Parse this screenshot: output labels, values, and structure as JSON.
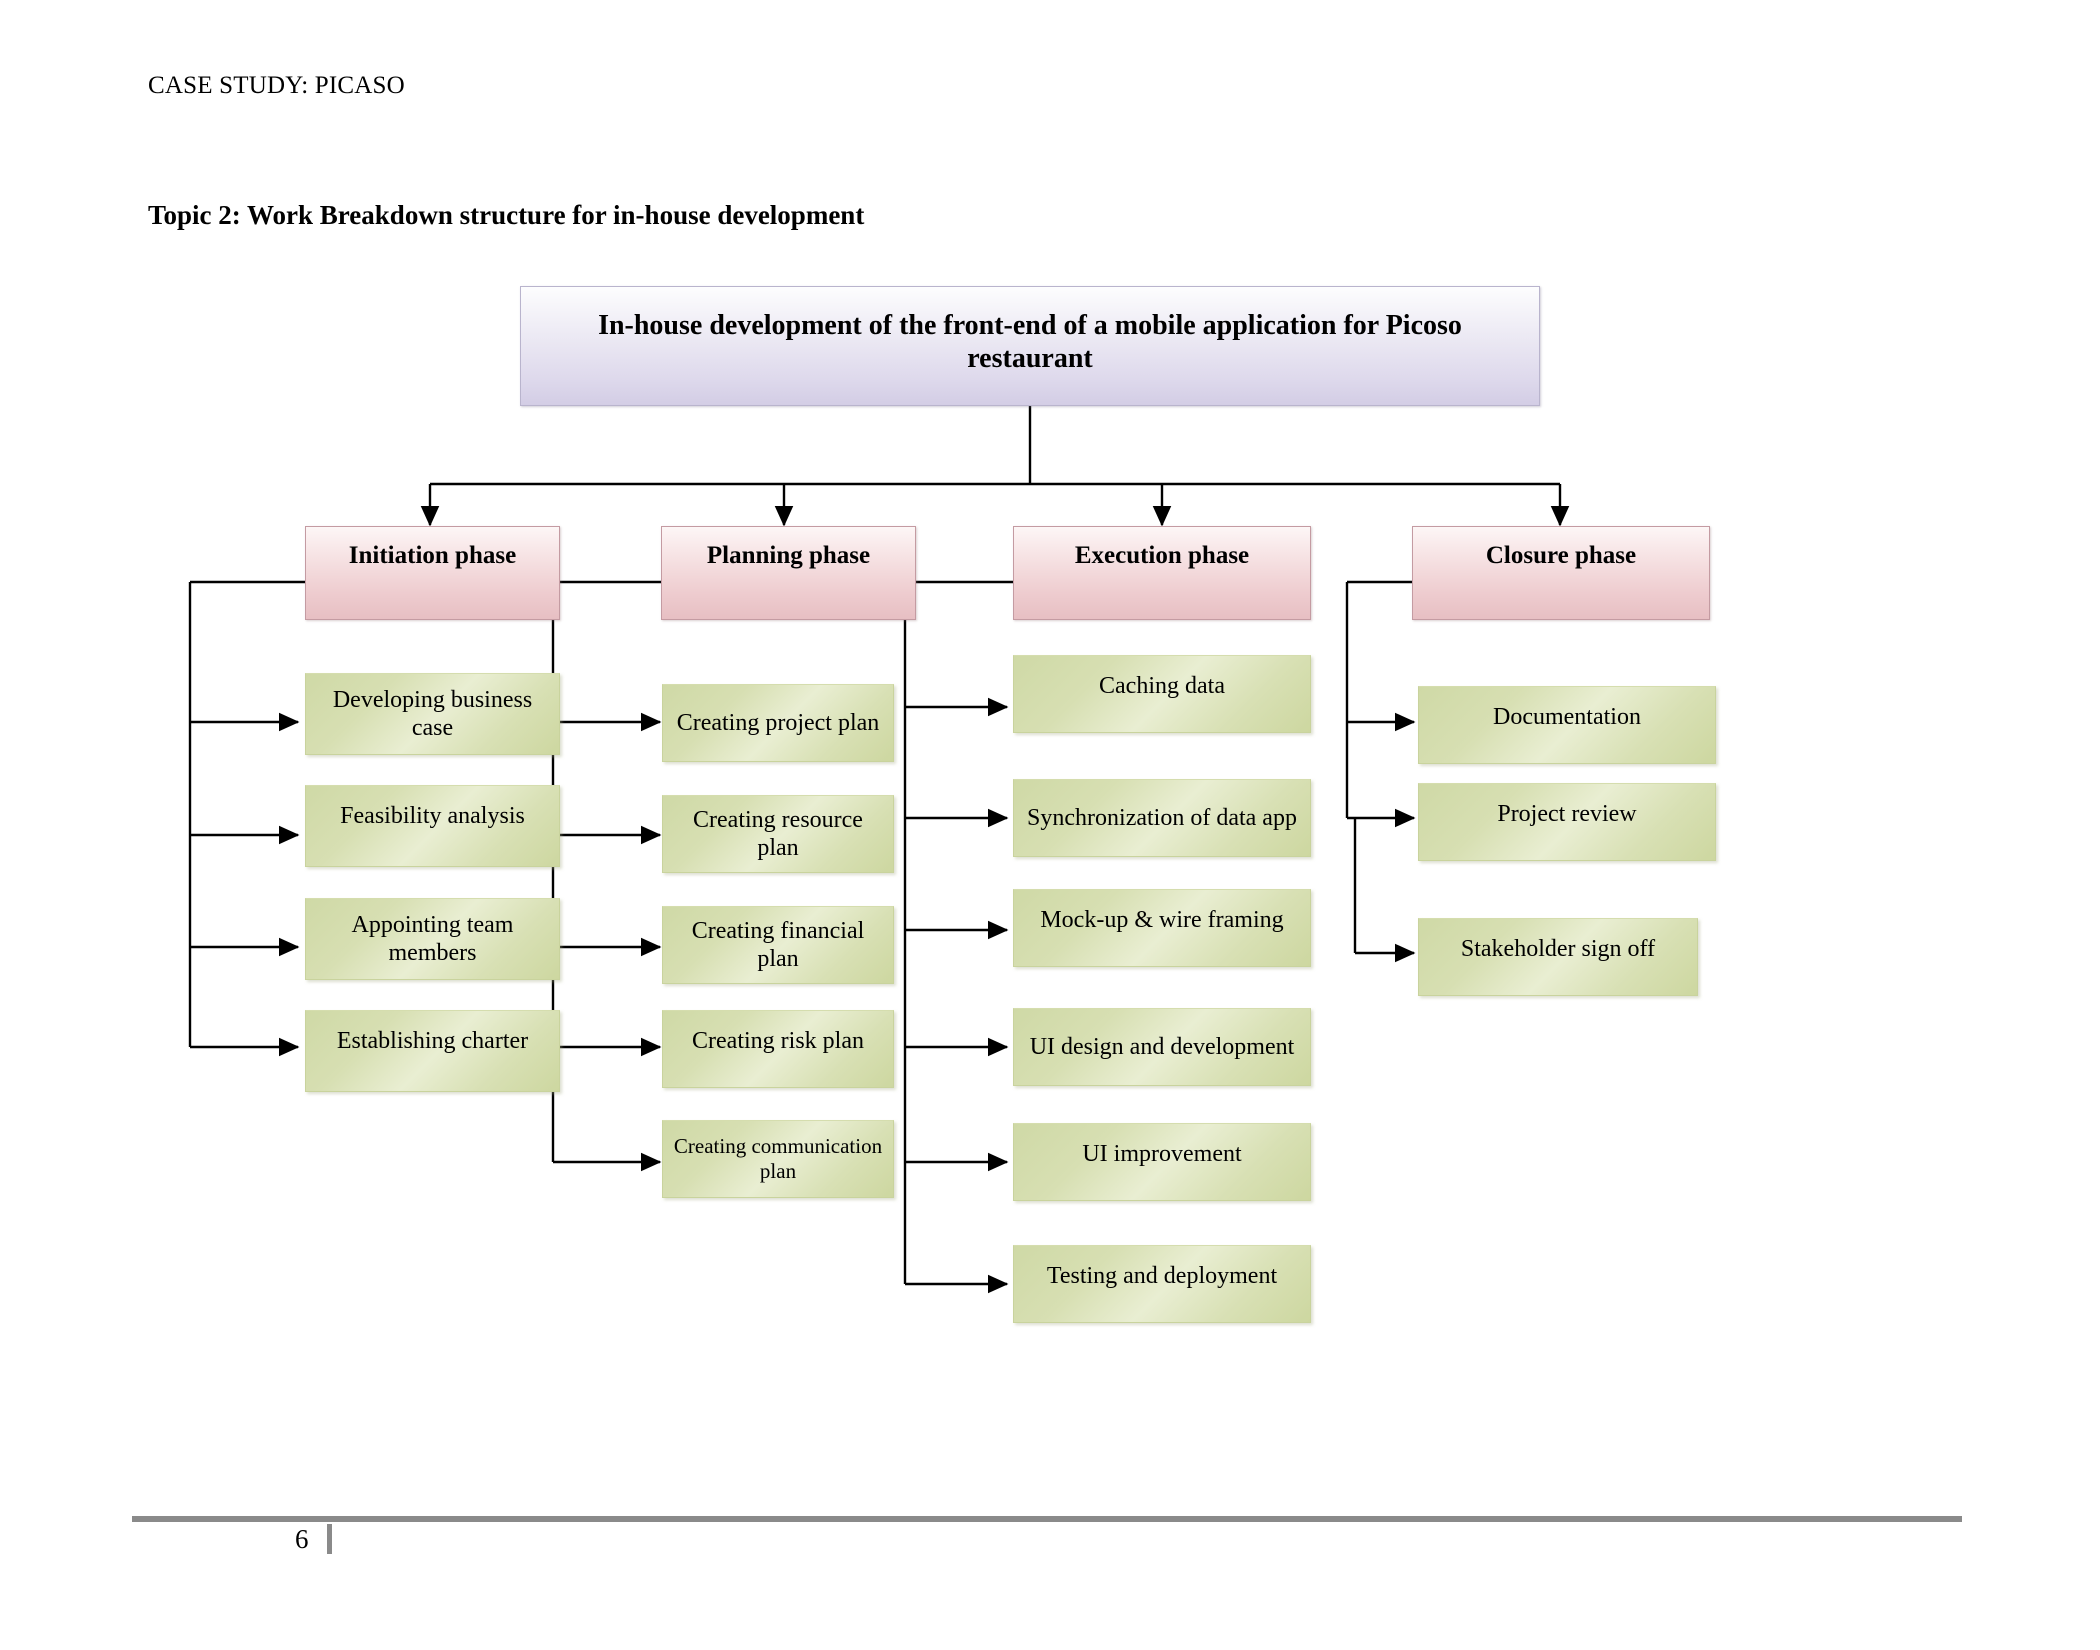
{
  "document": {
    "running_head": "CASE STUDY: PICASO",
    "topic_heading": "Topic 2: Work Breakdown structure for in-house development",
    "page_number": "6"
  },
  "colors": {
    "root_fill": "#ded9ec",
    "root_border": "#b9b4cd",
    "phase_fill": "#eecccf",
    "phase_border": "#c49ba2",
    "task_fill": "#d7dfb2",
    "task_border": "#c9d39d",
    "connector": "#000000",
    "footer_rule": "#8a8a8a"
  },
  "chart_data": {
    "type": "diagram",
    "diagram_type": "work-breakdown-structure",
    "title": "In-house development of the front-end of a mobile application for Picoso restaurant",
    "root": {
      "label": "In-house development of the front-end of a mobile application for Picoso restaurant"
    },
    "phases": [
      {
        "label": "Initiation phase",
        "tasks": [
          "Developing business case",
          "Feasibility analysis",
          "Appointing team members",
          "Establishing charter"
        ]
      },
      {
        "label": "Planning phase",
        "tasks": [
          "Creating project plan",
          "Creating resource plan",
          "Creating financial plan",
          "Creating risk plan",
          "Creating communication plan"
        ]
      },
      {
        "label": "Execution phase",
        "tasks": [
          "Caching data",
          "Synchronization of data app",
          "Mock-up & wire framing",
          "UI design and development",
          "UI improvement",
          "Testing and deployment"
        ]
      },
      {
        "label": "Closure phase",
        "tasks": [
          "Documentation",
          "Project review",
          "Stakeholder sign off"
        ]
      }
    ]
  },
  "diagram": {
    "root": {
      "label": "In-house development of the front-end of a mobile application for Picoso restaurant"
    },
    "phase_0": {
      "label": "Initiation phase"
    },
    "phase_1": {
      "label": "Planning phase"
    },
    "phase_2": {
      "label": "Execution phase"
    },
    "phase_3": {
      "label": "Closure phase"
    },
    "p0_t0": {
      "label": "Developing business case"
    },
    "p0_t1": {
      "label": "Feasibility analysis"
    },
    "p0_t2": {
      "label": "Appointing team members"
    },
    "p0_t3": {
      "label": "Establishing charter"
    },
    "p1_t0": {
      "label": "Creating project plan"
    },
    "p1_t1": {
      "label": "Creating resource plan"
    },
    "p1_t2": {
      "label": "Creating financial plan"
    },
    "p1_t3": {
      "label": "Creating risk plan"
    },
    "p1_t4": {
      "label": "Creating communication plan"
    },
    "p2_t0": {
      "label": "Caching data"
    },
    "p2_t1": {
      "label": "Synchronization of data app"
    },
    "p2_t2": {
      "label": "Mock-up & wire framing"
    },
    "p2_t3": {
      "label": "UI design and development"
    },
    "p2_t4": {
      "label": "UI improvement"
    },
    "p2_t5": {
      "label": "Testing and deployment"
    },
    "p3_t0": {
      "label": "Documentation"
    },
    "p3_t1": {
      "label": "Project review"
    },
    "p3_t2": {
      "label": "Stakeholder sign off"
    }
  }
}
